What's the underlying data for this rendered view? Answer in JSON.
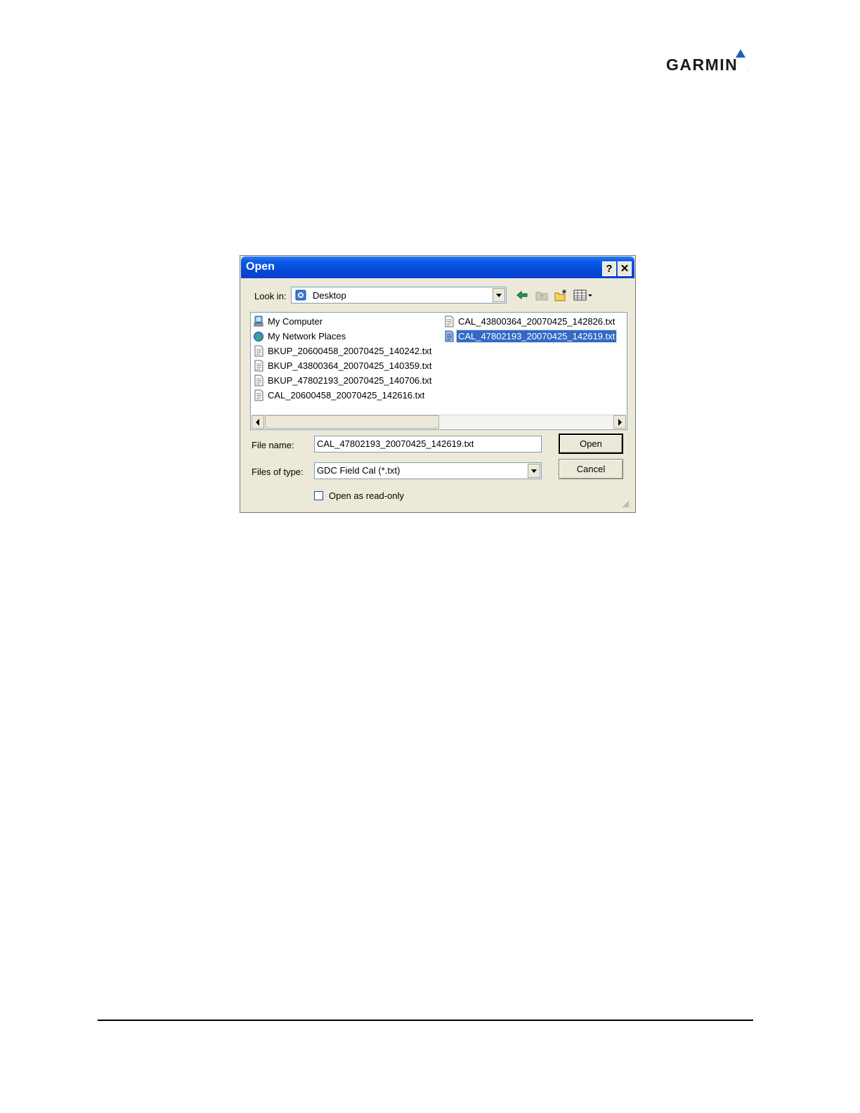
{
  "logo": {
    "text": "GARMIN",
    "trademark": "."
  },
  "dialog": {
    "title": "Open",
    "help_button": "?",
    "close_button": "✕",
    "look_in": {
      "label": "Look in:",
      "value": "Desktop"
    },
    "toolbar": {
      "back": "back-icon",
      "up": "up-folder-icon",
      "new_folder": "new-folder-icon",
      "views": "views-menu-icon"
    },
    "files": [
      {
        "name": "My Computer",
        "icon": "my-computer-icon"
      },
      {
        "name": "My Network Places",
        "icon": "network-places-icon"
      },
      {
        "name": "BKUP_20600458_20070425_140242.txt",
        "icon": "text-file-icon"
      },
      {
        "name": "BKUP_43800364_20070425_140359.txt",
        "icon": "text-file-icon"
      },
      {
        "name": "BKUP_47802193_20070425_140706.txt",
        "icon": "text-file-icon"
      },
      {
        "name": "CAL_20600458_20070425_142616.txt",
        "icon": "text-file-icon"
      },
      {
        "name": "CAL_43800364_20070425_142826.txt",
        "icon": "text-file-icon"
      },
      {
        "name": "CAL_47802193_20070425_142619.txt",
        "icon": "text-file-icon",
        "selected": true
      }
    ],
    "file_name": {
      "label": "File name:",
      "value": "CAL_47802193_20070425_142619.txt"
    },
    "file_type": {
      "label": "Files of type:",
      "value": "GDC Field Cal (*.txt)"
    },
    "open_button": "Open",
    "cancel_button": "Cancel",
    "read_only": {
      "label": "Open as read-only",
      "checked": false
    },
    "colors": {
      "titlebar": "#0a3fd6",
      "selection": "#316ac5",
      "face": "#ece9d8"
    }
  }
}
